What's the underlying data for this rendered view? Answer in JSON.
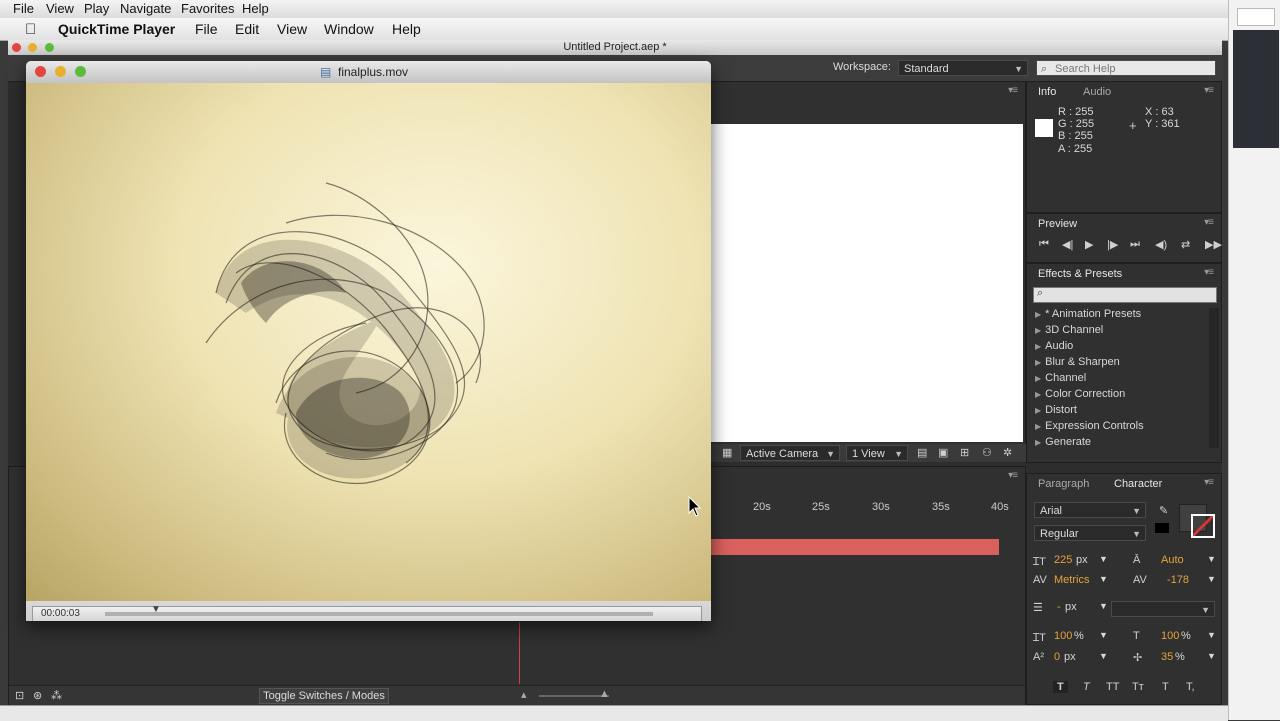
{
  "system_menu": {
    "items": [
      "File",
      "View",
      "Play",
      "Navigate",
      "Favorites",
      "Help"
    ]
  },
  "qt_menu": {
    "app": "QuickTime Player",
    "items": [
      "File",
      "Edit",
      "View",
      "Window",
      "Help"
    ]
  },
  "ae": {
    "title": "Untitled Project.aep *",
    "workspace_label": "Workspace:",
    "workspace_value": "Standard",
    "search_placeholder": "Search Help",
    "info": {
      "tab": "Info",
      "tab2": "Audio",
      "r": "R : 255",
      "g": "G : 255",
      "b": "B : 255",
      "a": "A : 255",
      "x": "X : 63",
      "y": "Y : 361"
    },
    "preview_tab": "Preview",
    "effects": {
      "tab": "Effects & Presets",
      "items": [
        "* Animation Presets",
        "3D Channel",
        "Audio",
        "Blur & Sharpen",
        "Channel",
        "Color Correction",
        "Distort",
        "Expression Controls",
        "Generate"
      ]
    },
    "viewer": {
      "camera": "Active Camera",
      "views": "1 View"
    },
    "timeline": {
      "ticks": [
        "20s",
        "25s",
        "30s",
        "35s",
        "40s"
      ],
      "toggle": "Toggle Switches / Modes"
    },
    "character": {
      "tab1": "Paragraph",
      "tab2": "Character",
      "font": "Arial",
      "style": "Regular",
      "size": "225",
      "size_unit": "px",
      "leading": "Auto",
      "kerning": "Metrics",
      "tracking": "-178",
      "stroke": "-",
      "stroke_unit": "px",
      "vscale": "100",
      "hscale": "100",
      "pct": "%",
      "baseline": "0",
      "baseline_unit": "px",
      "tsume": "35",
      "style_buttons": [
        "T",
        "T",
        "TT",
        "Tт",
        "T",
        "T,"
      ]
    }
  },
  "qt": {
    "filename": "finalplus.mov",
    "timecode": "00:00:03"
  }
}
